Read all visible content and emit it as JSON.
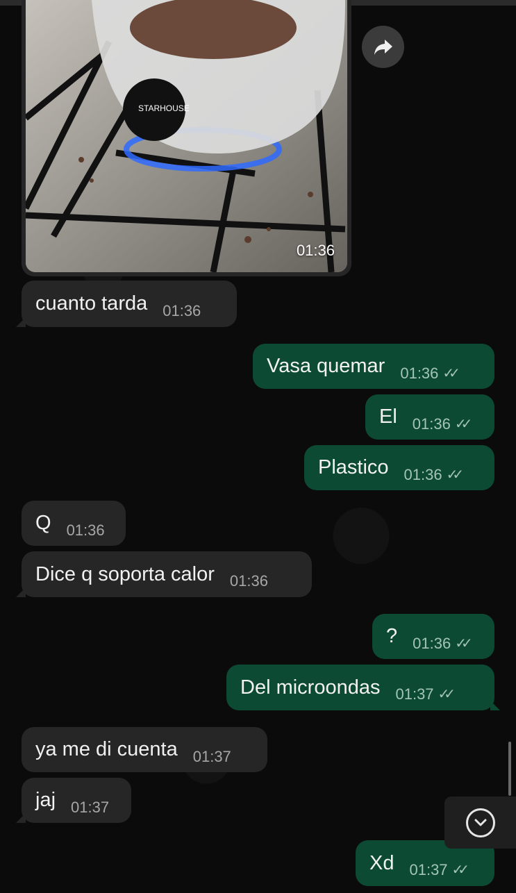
{
  "colors": {
    "incoming": "#262626",
    "outgoing": "#0c4a33",
    "background": "#0b0b0b"
  },
  "image_message": {
    "time": "01:36",
    "sticker_text": "STARHOUSE",
    "forward_icon": "forward-arrow-icon"
  },
  "messages": [
    {
      "text": "cuanto tarda",
      "time": "01:36",
      "dir": "in"
    },
    {
      "text": "Vasa quemar",
      "time": "01:36",
      "dir": "out",
      "status": "read"
    },
    {
      "text": "El",
      "time": "01:36",
      "dir": "out",
      "status": "read"
    },
    {
      "text": "Plastico",
      "time": "01:36",
      "dir": "out",
      "status": "read"
    },
    {
      "text": "Q",
      "time": "01:36",
      "dir": "in"
    },
    {
      "text": "Dice q soporta calor",
      "time": "01:36",
      "dir": "in"
    },
    {
      "text": "?",
      "time": "01:36",
      "dir": "out",
      "status": "read"
    },
    {
      "text": "Del microondas",
      "time": "01:37",
      "dir": "out",
      "status": "read"
    },
    {
      "text": "ya me di cuenta",
      "time": "01:37",
      "dir": "in"
    },
    {
      "text": "jaj",
      "time": "01:37",
      "dir": "in"
    },
    {
      "text": "Xd",
      "time": "01:37",
      "dir": "out",
      "status": "read"
    }
  ],
  "scroll_button_icon": "chevron-down-icon"
}
